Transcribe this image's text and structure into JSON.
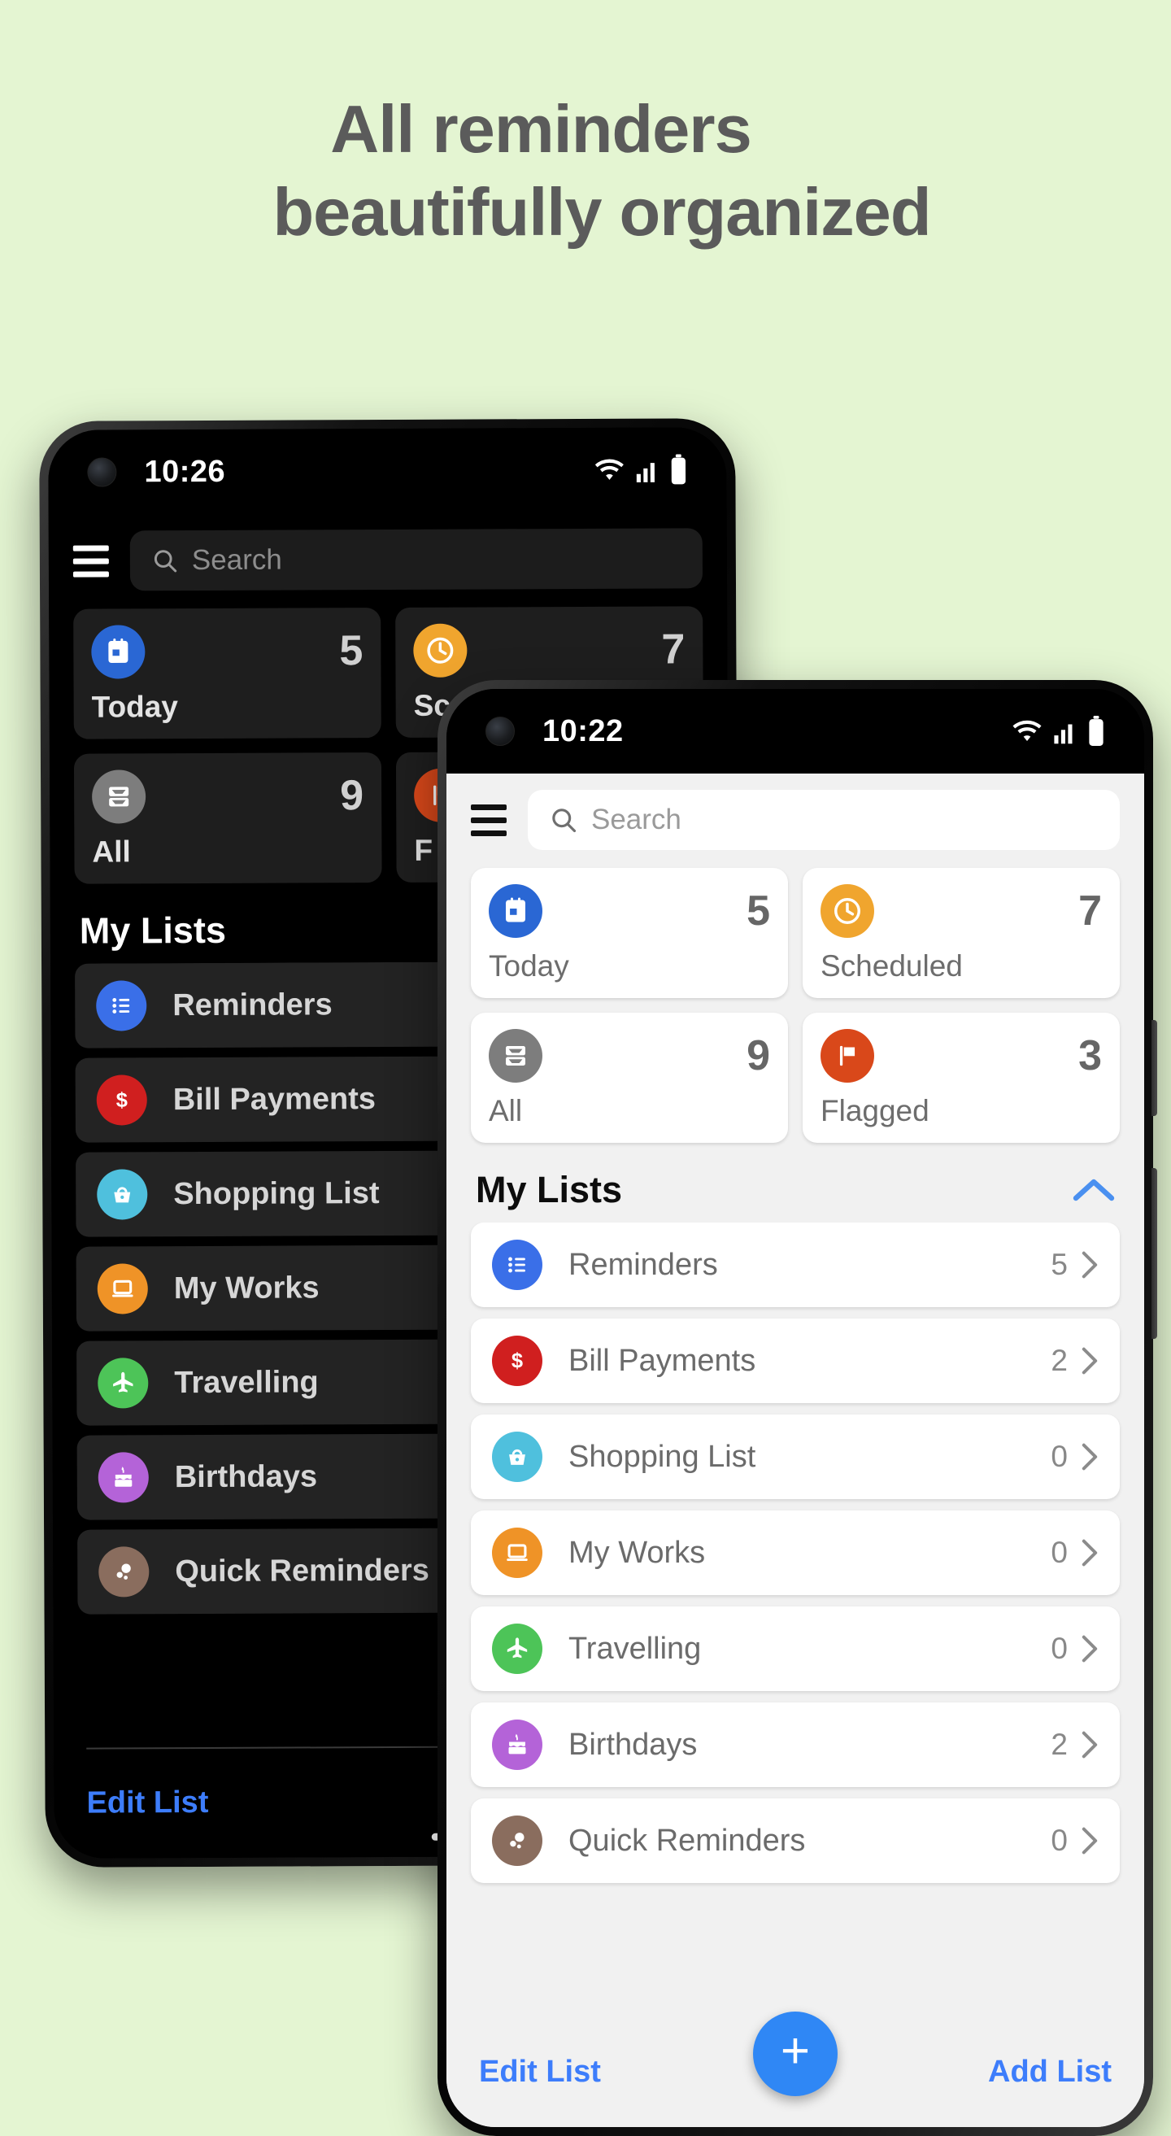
{
  "page": {
    "background_color": "#e4f5d2",
    "headline_line1": "All reminders",
    "headline_line2": "beautifully organized",
    "headline_color": "#5b5b5b"
  },
  "front_phone": {
    "theme": "light",
    "status_bar": {
      "time": "10:22",
      "wifi_icon": "wifi-icon",
      "signal_icon": "signal-icon",
      "battery_icon": "battery-icon",
      "camera_icon": "front-camera-punch-hole"
    },
    "header": {
      "menu_icon": "hamburger-menu-icon",
      "search_placeholder": "Search",
      "search_icon": "search-icon"
    },
    "summary_cards": [
      {
        "label": "Today",
        "count": "5",
        "icon": "calendar-icon",
        "color": "#2a67d4"
      },
      {
        "label": "Scheduled",
        "count": "7",
        "icon": "clock-icon",
        "color": "#f0a52e"
      },
      {
        "label": "All",
        "count": "9",
        "icon": "inbox-icon",
        "color": "#7d7d7d"
      },
      {
        "label": "Flagged",
        "count": "3",
        "icon": "flag-icon",
        "color": "#d9481a"
      }
    ],
    "my_lists": {
      "title": "My Lists",
      "collapse_icon": "chevron-up-icon",
      "collapse_color": "#4a90f0",
      "items": [
        {
          "label": "Reminders",
          "count": "5",
          "icon": "list-bullet-icon",
          "color": "#3a6fe8"
        },
        {
          "label": "Bill Payments",
          "count": "2",
          "icon": "dollar-icon",
          "color": "#d01f1f"
        },
        {
          "label": "Shopping List",
          "count": "0",
          "icon": "basket-icon",
          "color": "#4fc0dd"
        },
        {
          "label": "My Works",
          "count": "0",
          "icon": "laptop-icon",
          "color": "#ef9327"
        },
        {
          "label": "Travelling",
          "count": "0",
          "icon": "airplane-icon",
          "color": "#4dc458"
        },
        {
          "label": "Birthdays",
          "count": "2",
          "icon": "cake-icon",
          "color": "#b463d8"
        },
        {
          "label": "Quick Reminders",
          "count": "0",
          "icon": "bubbles-icon",
          "color": "#8a6d5e"
        }
      ]
    },
    "bottom_bar": {
      "edit_label": "Edit List",
      "add_label": "Add List",
      "fab_icon": "plus-icon",
      "fab_color": "#2f87f5",
      "link_color": "#3d7dfb"
    }
  },
  "back_phone": {
    "theme": "dark",
    "status_bar": {
      "time": "10:26",
      "wifi_icon": "wifi-icon",
      "signal_icon": "signal-icon",
      "battery_icon": "battery-icon",
      "camera_icon": "front-camera-punch-hole"
    },
    "header": {
      "menu_icon": "hamburger-menu-icon",
      "search_placeholder": "Search",
      "search_icon": "search-icon"
    },
    "summary_cards": [
      {
        "label": "Today",
        "count": "5",
        "icon": "calendar-icon",
        "color": "#2a67d4"
      },
      {
        "label": "Sc",
        "count": "7",
        "icon": "clock-icon",
        "color": "#f0a52e"
      },
      {
        "label": "All",
        "count": "9",
        "icon": "inbox-icon",
        "color": "#7d7d7d"
      },
      {
        "label": "F",
        "count": "",
        "icon": "flag-icon",
        "color": "#d9481a"
      }
    ],
    "my_lists": {
      "title": "My Lists",
      "items": [
        {
          "label": "Reminders",
          "icon": "list-bullet-icon",
          "color": "#3a6fe8"
        },
        {
          "label": "Bill Payments",
          "icon": "dollar-icon",
          "color": "#d01f1f"
        },
        {
          "label": "Shopping List",
          "icon": "basket-icon",
          "color": "#4fc0dd"
        },
        {
          "label": "My Works",
          "icon": "laptop-icon",
          "color": "#ef9327"
        },
        {
          "label": "Travelling",
          "icon": "airplane-icon",
          "color": "#4dc458"
        },
        {
          "label": "Birthdays",
          "icon": "cake-icon",
          "color": "#b463d8"
        },
        {
          "label": "Quick Reminders",
          "icon": "bubbles-icon",
          "color": "#8a6d5e"
        }
      ]
    },
    "bottom_bar": {
      "edit_label": "Edit List",
      "fab_icon": "plus-icon",
      "fab_color": "#2f87f5",
      "link_color": "#3d7dfb"
    }
  }
}
